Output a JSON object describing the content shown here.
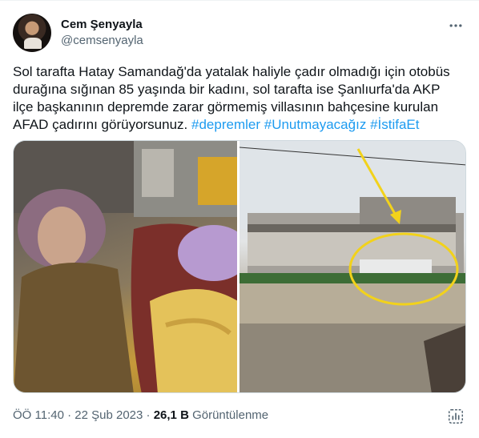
{
  "author": {
    "display_name": "Cem Şenyayla",
    "handle": "@cemsenyayla",
    "avatar_icon": "profile-photo"
  },
  "more_icon": "more-options-icon",
  "tweet": {
    "text": "Sol tarafta Hatay Samandağ'da yatalak haliyle çadır olmadığı için otobüs durağına sığınan 85 yaşında bir kadını, sol tarafta ise Şanlıurfa'da AKP ilçe başkanının depremde zarar görmemiş villasının bahçesine kurulan AFAD çadırını görüyorsunuz.",
    "hashtags": [
      "#depremler",
      "#Unutmayacağız",
      "#İstifaEt"
    ]
  },
  "media": {
    "left_photo_icon": "photo-elderly-woman-blanket",
    "right_photo_icon": "photo-villa-with-tent-circled"
  },
  "meta": {
    "time": "ÖÖ 11:40",
    "separator": "·",
    "date": "22 Şub 2023",
    "views_count": "26,1 B",
    "views_label": "Görüntülenme"
  },
  "colors": {
    "link": "#1d9bf0",
    "secondary_text": "#536471",
    "annotation_yellow": "#f2d21b"
  }
}
